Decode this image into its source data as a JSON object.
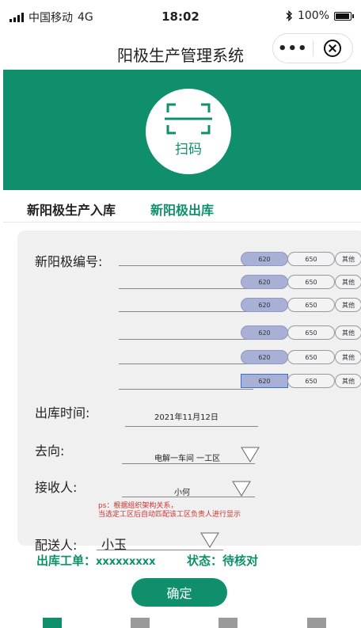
{
  "status_bar": {
    "carrier": "中国移动",
    "network": "4G",
    "time": "18:02",
    "battery_text": "100%",
    "battery_level": 1.0
  },
  "nav": {
    "title": "阳极生产管理系统",
    "more_label": "•••"
  },
  "scan": {
    "label": "扫码",
    "background_color": "#0f8f6c"
  },
  "tabs": [
    {
      "label": "新阳极生产入库",
      "active": false
    },
    {
      "label": "新阳极出库",
      "active": true
    }
  ],
  "form": {
    "anode_number_label": "新阳极编号:",
    "anode_rows": [
      {
        "options": [
          "620",
          "650",
          "其他"
        ],
        "selected": "620"
      },
      {
        "options": [
          "620",
          "650",
          "其他"
        ],
        "selected": "620"
      },
      {
        "options": [
          "620",
          "650",
          "其他"
        ],
        "selected": "620"
      },
      {
        "options": [
          "620",
          "650",
          "其他"
        ],
        "selected": "620"
      },
      {
        "options": [
          "620",
          "650",
          "其他"
        ],
        "selected": "620"
      },
      {
        "options": [
          "620",
          "650",
          "其他"
        ],
        "selected": "620"
      }
    ],
    "outbound_time_label": "出库时间:",
    "outbound_time_value": "2021年11月12日",
    "destination_label": "去向:",
    "destination_value": "电解一车间 一工区",
    "receiver_label": "接收人:",
    "receiver_value": "小何",
    "note_line1": "ps：根据组织架构关系，",
    "note_line2": "当选定工区后自动匹配该工区负责人进行显示",
    "deliverer_label": "配送人:",
    "deliverer_value": "小玉"
  },
  "footer": {
    "order_label": "出库工单：",
    "order_value": "xxxxxxxxx",
    "status_text": "状态：待核对"
  },
  "confirm_label": "确定",
  "colors": {
    "accent": "#0f8f6c",
    "selected_option": "#a9b0d6",
    "note_text": "#d23030"
  }
}
